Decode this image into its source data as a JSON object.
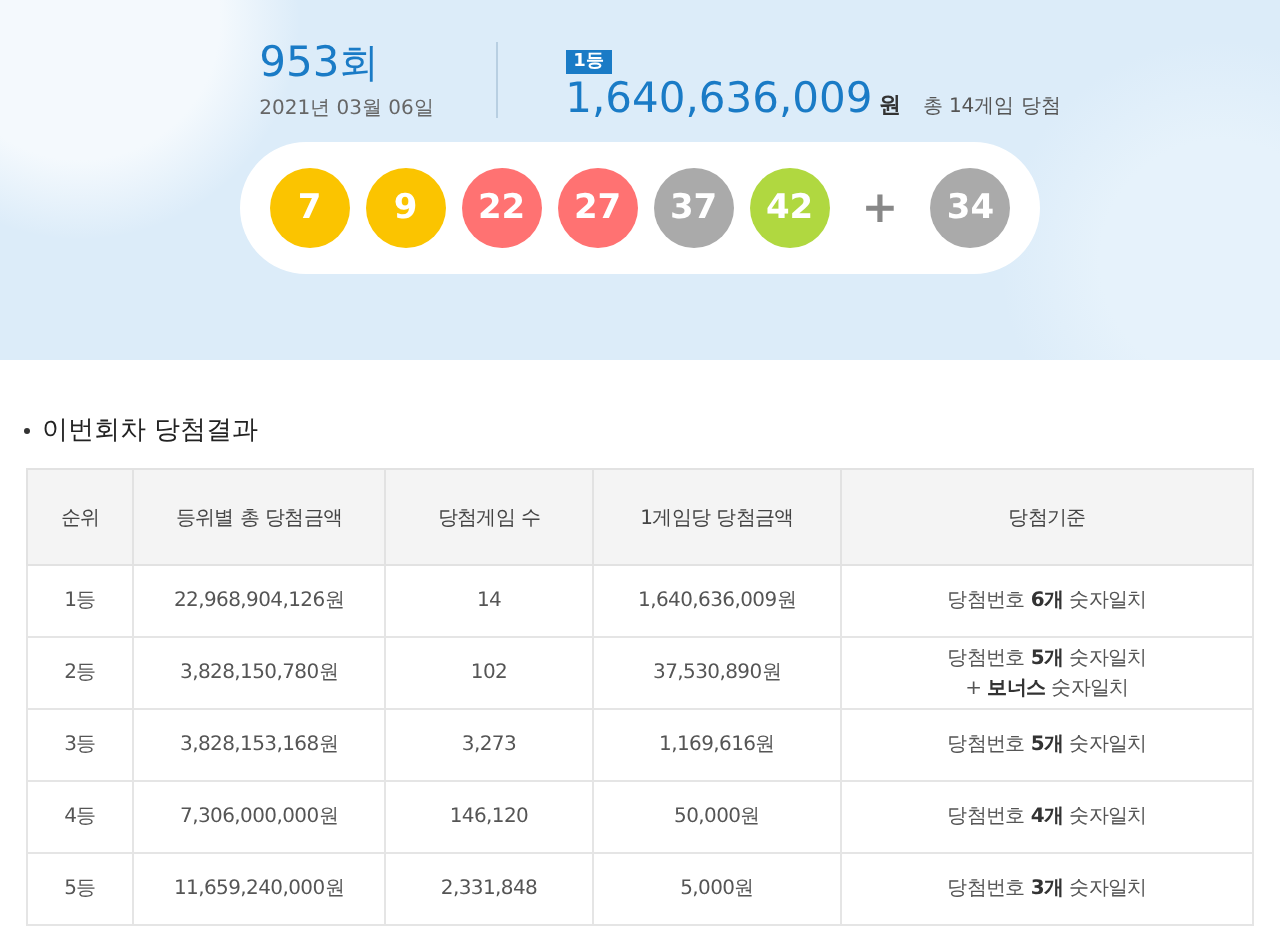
{
  "draw": {
    "round": "953",
    "round_unit": "회",
    "date": "2021년 03월 06일",
    "rank_badge": "1등",
    "amount": "1,640,636,009",
    "amount_unit": "원",
    "winners_note": "총 14게임 당첨",
    "balls": [
      {
        "number": "7",
        "color": "#fbc400"
      },
      {
        "number": "9",
        "color": "#fbc400"
      },
      {
        "number": "22",
        "color": "#ff7272"
      },
      {
        "number": "27",
        "color": "#ff7272"
      },
      {
        "number": "37",
        "color": "#aaaaaa"
      },
      {
        "number": "42",
        "color": "#b0d840"
      }
    ],
    "plus": "+",
    "bonus": {
      "number": "34",
      "color": "#aaaaaa"
    }
  },
  "section_title": "이번회차 당첨결과",
  "table": {
    "columns": [
      "순위",
      "등위별 총 당첨금액",
      "당첨게임 수",
      "1게임당 당첨금액",
      "당첨기준"
    ],
    "rows": [
      {
        "cells": [
          "1등",
          "22,968,904,126원",
          "14",
          "1,640,636,009원"
        ],
        "criteria": [
          "당첨번호 **6개** 숫자일치"
        ]
      },
      {
        "cells": [
          "2등",
          "3,828,150,780원",
          "102",
          "37,530,890원"
        ],
        "criteria": [
          "당첨번호 **5개** 숫자일치",
          "+ **보너스** 숫자일치"
        ]
      },
      {
        "cells": [
          "3등",
          "3,828,153,168원",
          "3,273",
          "1,169,616원"
        ],
        "criteria": [
          "당첨번호 **5개** 숫자일치"
        ]
      },
      {
        "cells": [
          "4등",
          "7,306,000,000원",
          "146,120",
          "50,000원"
        ],
        "criteria": [
          "당첨번호 **4개** 숫자일치"
        ]
      },
      {
        "cells": [
          "5등",
          "11,659,240,000원",
          "2,331,848",
          "5,000원"
        ],
        "criteria": [
          "당첨번호 **3개** 숫자일치"
        ]
      }
    ]
  }
}
